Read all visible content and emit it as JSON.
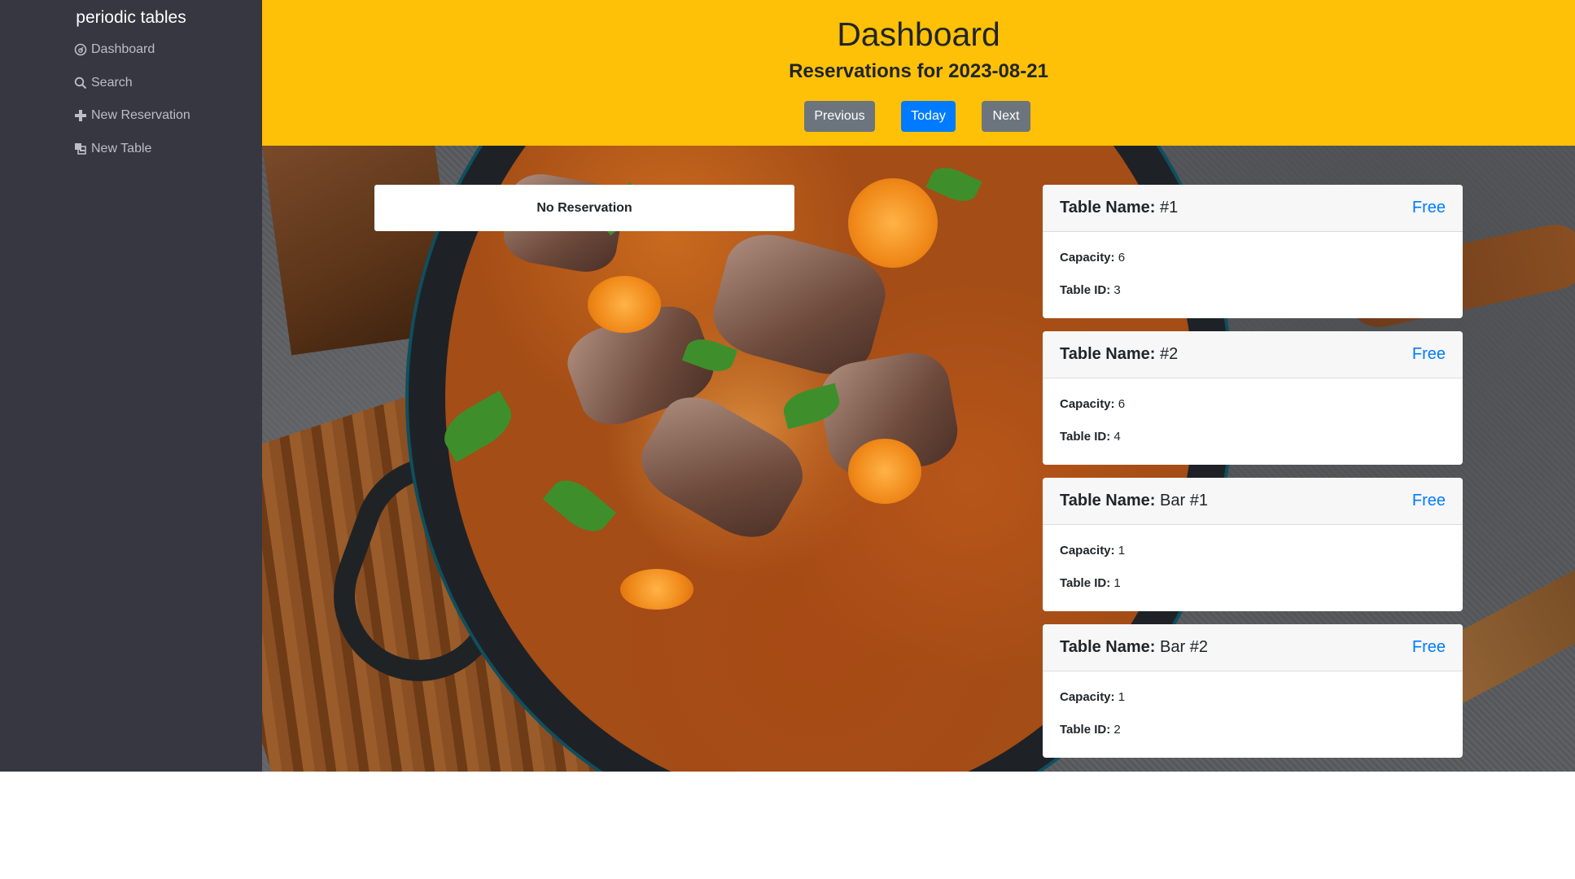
{
  "sidebar": {
    "brand": "periodic tables",
    "items": [
      {
        "label": "Dashboard",
        "icon": "dashboard-icon"
      },
      {
        "label": "Search",
        "icon": "search-icon"
      },
      {
        "label": "New Reservation",
        "icon": "plus-icon"
      },
      {
        "label": "New Table",
        "icon": "layers-icon"
      }
    ]
  },
  "header": {
    "title": "Dashboard",
    "subtitle": "Reservations for 2023-08-21",
    "buttons": {
      "previous": "Previous",
      "today": "Today",
      "next": "Next"
    }
  },
  "reservations": {
    "empty_label": "No Reservation"
  },
  "tables": [
    {
      "name_label": "Table Name:",
      "name": "#1",
      "status": "Free",
      "capacity_label": "Capacity:",
      "capacity": "6",
      "id_label": "Table ID:",
      "id": "3"
    },
    {
      "name_label": "Table Name:",
      "name": "#2",
      "status": "Free",
      "capacity_label": "Capacity:",
      "capacity": "6",
      "id_label": "Table ID:",
      "id": "4"
    },
    {
      "name_label": "Table Name:",
      "name": "Bar #1",
      "status": "Free",
      "capacity_label": "Capacity:",
      "capacity": "1",
      "id_label": "Table ID:",
      "id": "1"
    },
    {
      "name_label": "Table Name:",
      "name": "Bar #2",
      "status": "Free",
      "capacity_label": "Capacity:",
      "capacity": "1",
      "id_label": "Table ID:",
      "id": "2"
    }
  ],
  "colors": {
    "header_bg": "#ffc107",
    "sidebar_bg": "#363740",
    "primary": "#007bff",
    "secondary": "#6c757d"
  }
}
